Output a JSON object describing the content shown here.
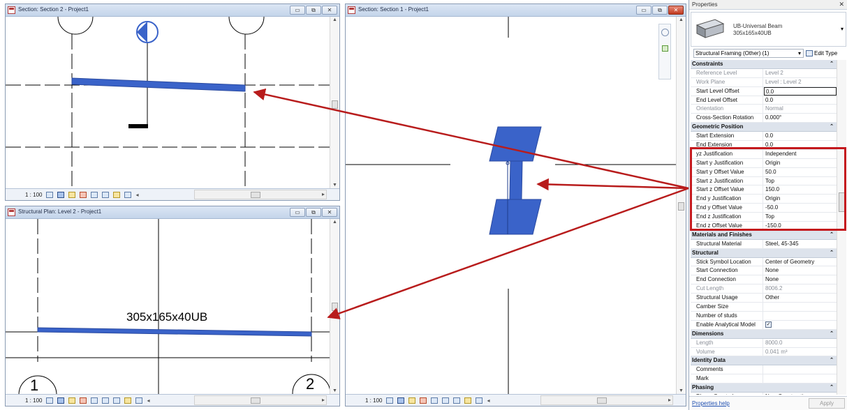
{
  "views": {
    "section2": {
      "title": "Section: Section 2 - Project1",
      "scale": "1 : 100"
    },
    "plan": {
      "title": "Structural Plan: Level 2 - Project1",
      "scale": "1 : 100",
      "beam_tag": "305x165x40UB",
      "grid_left": "1",
      "grid_right": "2"
    },
    "section1": {
      "title": "Section: Section 1 - Project1",
      "scale": "1 : 100"
    }
  },
  "window_buttons": {
    "minimize": "▭",
    "restore": "⧉",
    "close": "✕"
  },
  "properties": {
    "title": "Properties",
    "close": "✕",
    "type_name_line1": "UB-Universal Beam",
    "type_name_line2": "305x165x40UB",
    "filter": "Structural Framing (Other) (1)",
    "edit_type": "Edit Type",
    "groups": [
      {
        "name": "Constraints",
        "rows": [
          {
            "name": "Reference Level",
            "value": "Level 2",
            "readonly": true
          },
          {
            "name": "Work Plane",
            "value": "Level : Level 2",
            "readonly": true
          },
          {
            "name": "Start Level Offset",
            "value": "0.0",
            "editing": true
          },
          {
            "name": "End Level Offset",
            "value": "0.0"
          },
          {
            "name": "Orientation",
            "value": "Normal",
            "readonly": true
          },
          {
            "name": "Cross-Section Rotation",
            "value": "0.000°"
          }
        ]
      },
      {
        "name": "Geometric Position",
        "rows": [
          {
            "name": "Start Extension",
            "value": "0.0"
          },
          {
            "name": "End Extension",
            "value": "0.0"
          },
          {
            "name": "yz Justification",
            "value": "Independent"
          },
          {
            "name": "Start y Justification",
            "value": "Origin"
          },
          {
            "name": "Start y Offset Value",
            "value": "50.0"
          },
          {
            "name": "Start z Justification",
            "value": "Top"
          },
          {
            "name": "Start z Offset Value",
            "value": "150.0"
          },
          {
            "name": "End y Justification",
            "value": "Origin"
          },
          {
            "name": "End y Offset Value",
            "value": "-50.0"
          },
          {
            "name": "End z Justification",
            "value": "Top"
          },
          {
            "name": "End z Offset Value",
            "value": "-150.0"
          }
        ]
      },
      {
        "name": "Materials and Finishes",
        "rows": [
          {
            "name": "Structural Material",
            "value": "Steel, 45-345"
          }
        ]
      },
      {
        "name": "Structural",
        "rows": [
          {
            "name": "Stick Symbol Location",
            "value": "Center of Geometry"
          },
          {
            "name": "Start Connection",
            "value": "None"
          },
          {
            "name": "End Connection",
            "value": "None"
          },
          {
            "name": "Cut Length",
            "value": "8006.2",
            "readonly": true
          },
          {
            "name": "Structural Usage",
            "value": "Other"
          },
          {
            "name": "Camber Size",
            "value": ""
          },
          {
            "name": "Number of studs",
            "value": ""
          },
          {
            "name": "Enable Analytical Model",
            "value": "",
            "checkbox": true
          }
        ]
      },
      {
        "name": "Dimensions",
        "rows": [
          {
            "name": "Length",
            "value": "8000.0",
            "readonly": true
          },
          {
            "name": "Volume",
            "value": "0.041 m³",
            "readonly": true
          }
        ]
      },
      {
        "name": "Identity Data",
        "rows": [
          {
            "name": "Comments",
            "value": ""
          },
          {
            "name": "Mark",
            "value": ""
          }
        ]
      },
      {
        "name": "Phasing",
        "rows": [
          {
            "name": "Phase Created",
            "value": "New Construction"
          }
        ]
      }
    ],
    "help_link": "Properties help",
    "apply": "Apply"
  },
  "colors": {
    "beam": "#3a63c9",
    "arrow": "#b81c1c",
    "highlight": "#c4181d"
  }
}
